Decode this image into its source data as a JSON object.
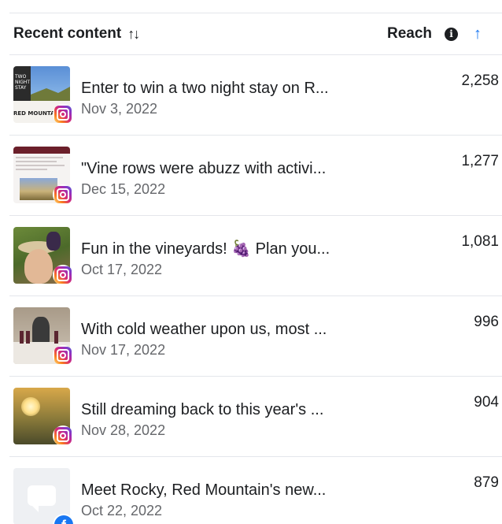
{
  "header": {
    "recent_label": "Recent content",
    "sort_glyph": "↑↓",
    "reach_label": "Reach",
    "info_glyph": "i",
    "arrow_glyph": "↑"
  },
  "colors": {
    "accent": "#1877f2",
    "text": "#1c1e21",
    "muted": "#65676b",
    "divider": "#e4e6eb"
  },
  "thumb_text": {
    "t1_lines": "TWO\nNIGHT\nSTAY",
    "t1_footer": "RED MOUNTAIN B",
    "fb_glyph": "f"
  },
  "rows": [
    {
      "title": "Enter to win a two night stay on R...",
      "date": "Nov 3, 2022",
      "reach": "2,258",
      "platform": "instagram-icon"
    },
    {
      "title": "\"Vine rows were abuzz with activi...",
      "date": "Dec 15, 2022",
      "reach": "1,277",
      "platform": "instagram-icon"
    },
    {
      "title": "Fun in the vineyards! 🍇 Plan you...",
      "date": "Oct 17, 2022",
      "reach": "1,081",
      "platform": "instagram-icon"
    },
    {
      "title": "With cold weather upon us, most ...",
      "date": "Nov 17, 2022",
      "reach": "996",
      "platform": "instagram-icon"
    },
    {
      "title": "Still dreaming back to this year's ...",
      "date": "Nov 28, 2022",
      "reach": "904",
      "platform": "instagram-icon"
    },
    {
      "title": "Meet Rocky, Red Mountain's new...",
      "date": "Oct 22, 2022",
      "reach": "879",
      "platform": "facebook-icon"
    }
  ]
}
